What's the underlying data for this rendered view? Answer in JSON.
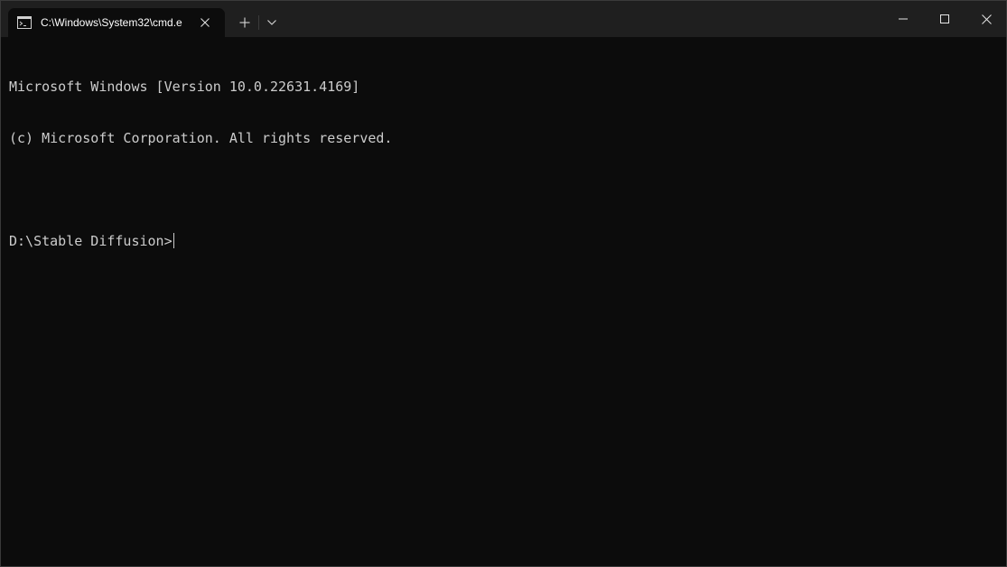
{
  "tab": {
    "title": "C:\\Windows\\System32\\cmd.e",
    "icon": "terminal-icon"
  },
  "titlebar": {
    "new_tab_icon": "plus-icon",
    "dropdown_icon": "chevron-down-icon",
    "minimize_icon": "minimize-icon",
    "maximize_icon": "maximize-icon",
    "close_icon": "close-icon"
  },
  "console": {
    "lines": [
      "Microsoft Windows [Version 10.0.22631.4169]",
      "(c) Microsoft Corporation. All rights reserved.",
      ""
    ],
    "prompt": "D:\\Stable Diffusion>"
  },
  "colors": {
    "titlebar_bg": "#1f1f1f",
    "console_bg": "#0c0c0c",
    "console_fg": "#cccccc"
  }
}
